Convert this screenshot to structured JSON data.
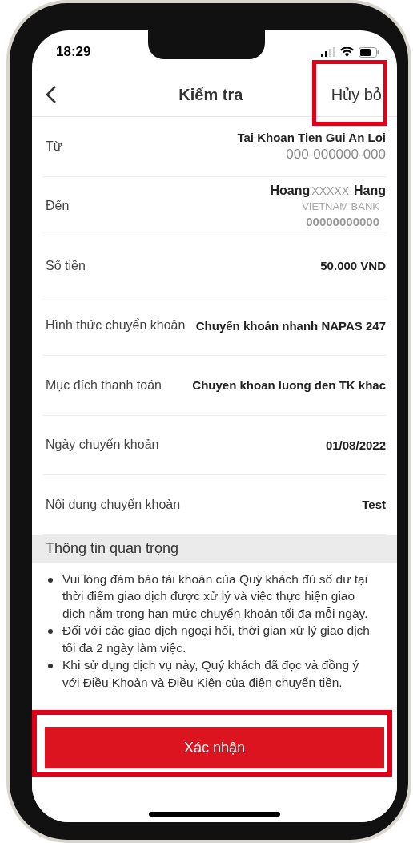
{
  "status_bar": {
    "time": "18:29"
  },
  "nav": {
    "title": "Kiểm tra",
    "cancel": {
      "label": "Hủy bỏ",
      "highlighted": true
    }
  },
  "rows": [
    {
      "label": "Từ",
      "lines": [
        {
          "kind": "main",
          "text": "Tai Khoan Tien Gui An Loi"
        },
        {
          "kind": "sub",
          "text": "000-000000-000"
        }
      ]
    },
    {
      "label": "Đến",
      "lines": [
        {
          "kind": "name",
          "first": "Hoang",
          "masked": "XXXXX",
          "last": "Hang"
        },
        {
          "kind": "bank",
          "text": "VIETNAM BANK"
        },
        {
          "kind": "blurred",
          "text": "00000000000"
        }
      ]
    },
    {
      "label": "Số tiền",
      "lines": [
        {
          "kind": "main",
          "text": "50.000 VND"
        }
      ]
    },
    {
      "label": "Hình thức chuyển khoản",
      "lines": [
        {
          "kind": "main",
          "text": "Chuyển khoản nhanh NAPAS 247"
        }
      ]
    },
    {
      "label": "Mục đích thanh toán",
      "lines": [
        {
          "kind": "main",
          "text": "Chuyen khoan luong den TK khac"
        }
      ]
    },
    {
      "label": "Ngày chuyển khoản",
      "lines": [
        {
          "kind": "main",
          "text": "01/08/2022"
        }
      ]
    },
    {
      "label": "Nội dung chuyển khoản",
      "lines": [
        {
          "kind": "main",
          "text": "Test"
        }
      ]
    }
  ],
  "important": {
    "title": "Thông tin quan trọng",
    "bullets": [
      {
        "text": "Vui lòng đảm bảo tài khoản của Quý khách đủ số dư tại thời điểm giao dịch được xử lý và việc thực hiện giao dịch nằm trong hạn mức chuyển khoản tối đa mỗi ngày."
      },
      {
        "text": "Đối với các giao dịch ngoại hối, thời gian xử lý giao dịch tối đa 2 ngày làm việc."
      },
      {
        "text": "Khi sử dụng dịch vụ này, Quý khách đã đọc và đồng ý với",
        "link": "Điều Khoản và Điều Kiện",
        "after": "của điện chuyển tiền."
      }
    ]
  },
  "confirm": {
    "label": "Xác nhận",
    "highlighted": true
  }
}
